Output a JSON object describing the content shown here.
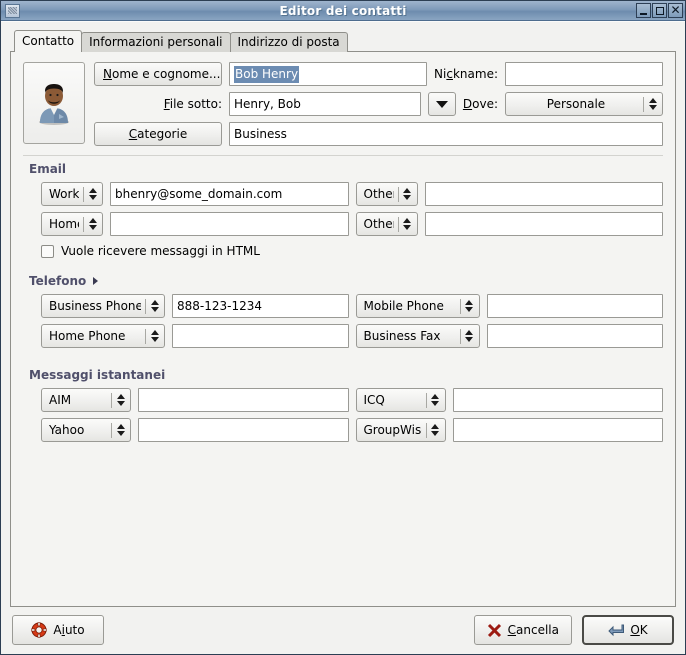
{
  "window": {
    "title": "Editor dei contatti",
    "icon": "contact-window-icon",
    "buttons": {
      "minimize": "minimize-button",
      "maximize": "maximize-button",
      "close": "close-button"
    }
  },
  "tabs": [
    {
      "label": "Contatto",
      "active": true
    },
    {
      "label": "Informazioni personali",
      "active": false
    },
    {
      "label": "Indirizzo di posta",
      "active": false
    }
  ],
  "contact": {
    "avatar_icon": "contact-avatar-icon",
    "full_name_button": "Nome e cognome...",
    "full_name_value": "Bob Henry",
    "full_name_selected": true,
    "nickname_label": "Nickname:",
    "nickname_value": "",
    "file_under_label": "File sotto:",
    "file_under_value": "Henry, Bob",
    "where_label": "Dove:",
    "where_value": "Personale",
    "categories_button": "Categorie",
    "categories_value": "Business"
  },
  "email": {
    "title": "Email",
    "rows": [
      {
        "left_type": "Work",
        "left_value": "bhenry@some_domain.com",
        "right_type": "Other",
        "right_value": ""
      },
      {
        "left_type": "Home",
        "left_value": "",
        "right_type": "Other",
        "right_value": ""
      }
    ],
    "html_checkbox_label": "Vuole ricevere messaggi in HTML",
    "html_checkbox_checked": false
  },
  "phone": {
    "title": "Telefono",
    "expander": "expander-arrow",
    "rows": [
      {
        "left_type": "Business Phone",
        "left_value": "888-123-1234",
        "right_type": "Mobile Phone",
        "right_value": ""
      },
      {
        "left_type": "Home Phone",
        "left_value": "",
        "right_type": "Business Fax",
        "right_value": ""
      }
    ]
  },
  "im": {
    "title": "Messaggi istantanei",
    "rows": [
      {
        "left_type": "AIM",
        "left_value": "",
        "right_type": "ICQ",
        "right_value": ""
      },
      {
        "left_type": "Yahoo",
        "left_value": "",
        "right_type": "GroupWise",
        "right_value": ""
      }
    ]
  },
  "actions": {
    "help_label": "Aiuto",
    "help_icon": "help-lifering-icon",
    "cancel_label": "Cancella",
    "cancel_icon": "cancel-x-icon",
    "ok_label": "OK",
    "ok_icon": "ok-enter-icon",
    "ok_is_default": true
  },
  "colors": {
    "titlebar_accent": "#7e9ab9",
    "group_title": "#50506b",
    "selection": "#6c8cb2",
    "window_bg": "#f2f2f0",
    "panel_bg": "#f4f4f2"
  }
}
